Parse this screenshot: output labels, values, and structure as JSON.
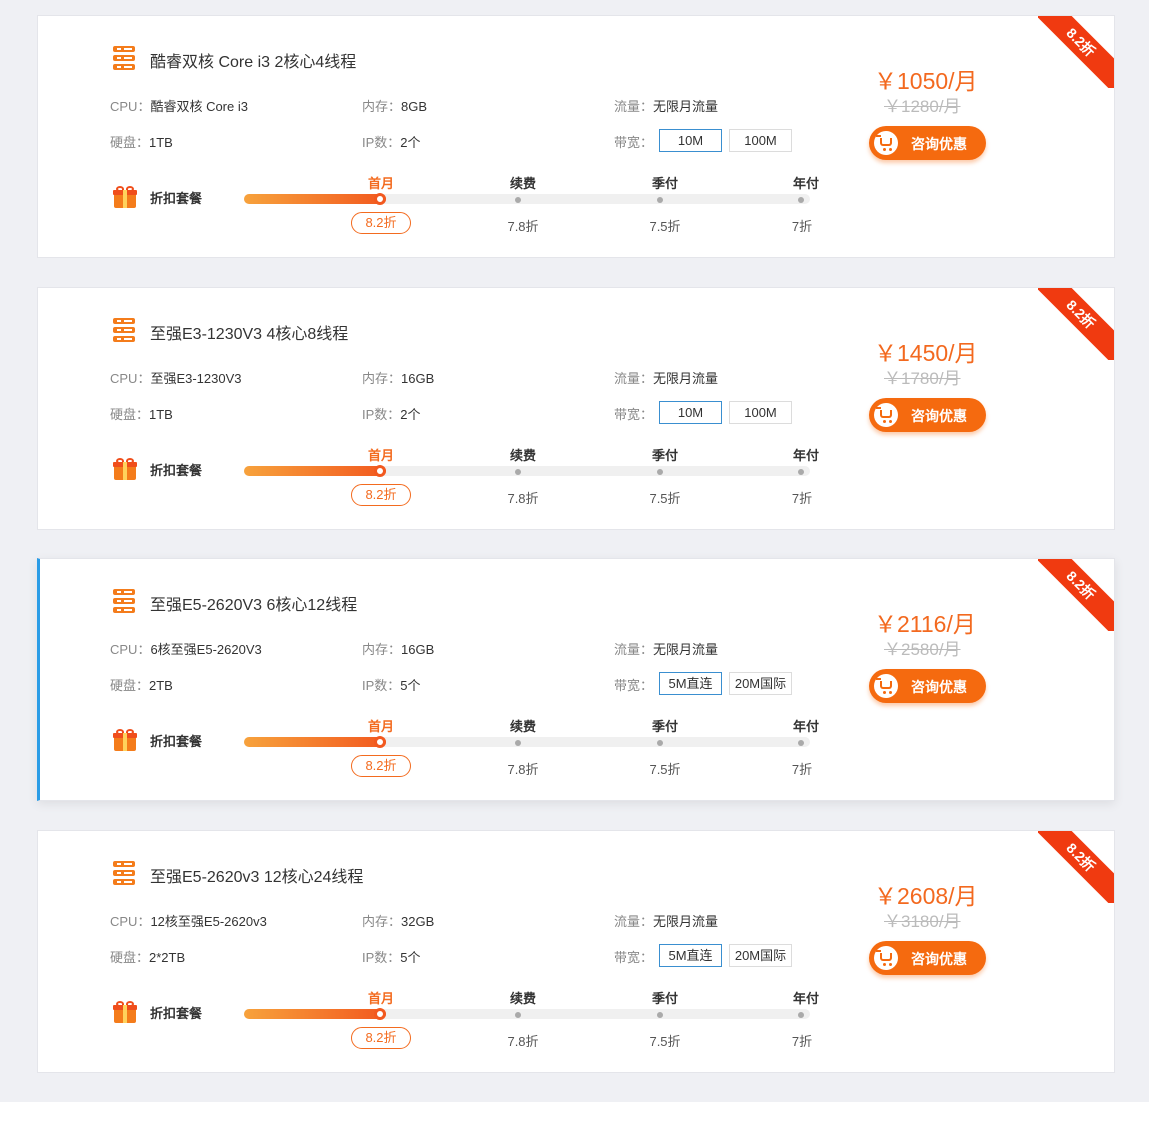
{
  "labels": {
    "cpu_key": "CPU：",
    "mem_key": "内存：",
    "traffic_key": "流量：",
    "disk_key": "硬盘：",
    "ip_key": "IP数：",
    "bw_key": "带宽：",
    "discount_label": "折扣套餐",
    "consult_button": "咨询优惠"
  },
  "plans": [
    "首月",
    "续费",
    "季付",
    "年付"
  ],
  "rates": [
    "8.2折",
    "7.8折",
    "7.5折",
    "7折"
  ],
  "selected_plan_progress": 0.24,
  "colors": {
    "accent": "#f3691f",
    "ribbon": "#f03a10",
    "active_border": "#2b9ce6"
  },
  "products": [
    {
      "badge": "8.2折",
      "title": "酷睿双核 Core i3 2核心4线程",
      "cpu": "酷睿双核 Core i3",
      "memory": "8GB",
      "traffic": "无限月流量",
      "disk": "1TB",
      "ip": "2个",
      "bandwidth": [
        "10M",
        "100M"
      ],
      "price": "￥1050/月",
      "old_price": "￥1280/月"
    },
    {
      "badge": "8.2折",
      "title": "至强E3-1230V3 4核心8线程",
      "cpu": "至强E3-1230V3",
      "memory": "16GB",
      "traffic": "无限月流量",
      "disk": "1TB",
      "ip": "2个",
      "bandwidth": [
        "10M",
        "100M"
      ],
      "price": "￥1450/月",
      "old_price": "￥1780/月"
    },
    {
      "badge": "8.2折",
      "title": "至强E5-2620V3 6核心12线程",
      "cpu": "6核至强E5-2620V3",
      "memory": "16GB",
      "traffic": "无限月流量",
      "disk": "2TB",
      "ip": "5个",
      "bandwidth": [
        "5M直连",
        "20M国际"
      ],
      "price": "￥2116/月",
      "old_price": "￥2580/月"
    },
    {
      "badge": "8.2折",
      "title": "至强E5-2620v3 12核心24线程",
      "cpu": "12核至强E5-2620v3",
      "memory": "32GB",
      "traffic": "无限月流量",
      "disk": "2*2TB",
      "ip": "5个",
      "bandwidth": [
        "5M直连",
        "20M国际"
      ],
      "price": "￥2608/月",
      "old_price": "￥3180/月"
    }
  ]
}
